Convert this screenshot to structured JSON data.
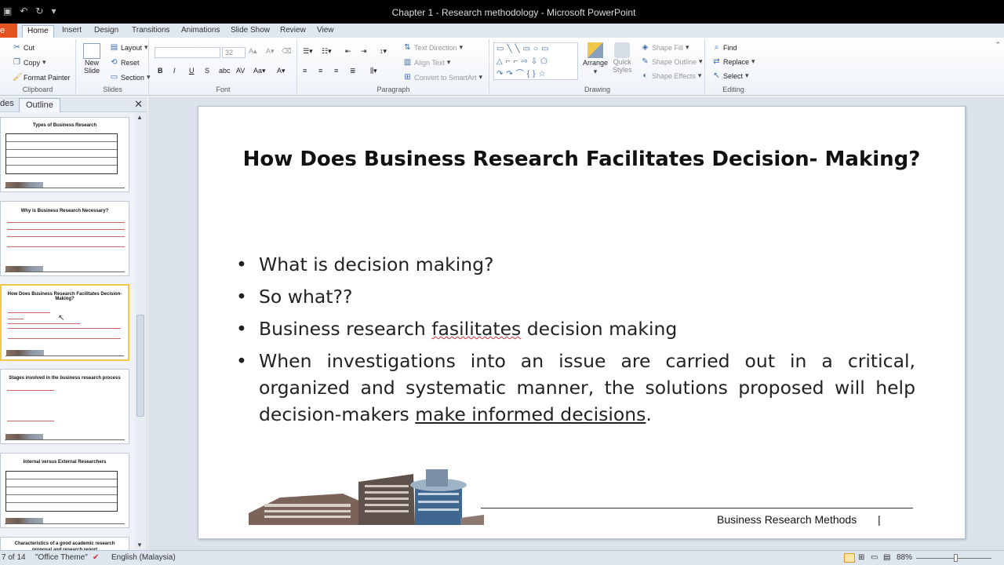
{
  "window": {
    "title": "Chapter 1 - Research methodology  -  Microsoft PowerPoint"
  },
  "tabs": {
    "file": "e",
    "items": [
      "Home",
      "Insert",
      "Design",
      "Transitions",
      "Animations",
      "Slide Show",
      "Review",
      "View"
    ],
    "active": "Home"
  },
  "ribbon": {
    "clipboard": {
      "cut": "Cut",
      "copy": "Copy",
      "format_painter": "Format Painter",
      "label": "Clipboard"
    },
    "slides": {
      "new_slide": "New",
      "new_slide2": "Slide",
      "layout": "Layout",
      "reset": "Reset",
      "section": "Section",
      "label": "Slides"
    },
    "font": {
      "size": "32",
      "label": "Font"
    },
    "paragraph": {
      "text_direction": "Text Direction",
      "align_text": "Align Text",
      "convert_smartart": "Convert to SmartArt",
      "label": "Paragraph"
    },
    "drawing": {
      "arrange": "Arrange",
      "quick_styles": "Quick",
      "quick_styles2": "Styles",
      "shape_fill": "Shape Fill",
      "shape_outline": "Shape Outline",
      "shape_effects": "Shape Effects",
      "label": "Drawing"
    },
    "editing": {
      "find": "Find",
      "replace": "Replace",
      "select": "Select",
      "label": "Editing"
    }
  },
  "pane": {
    "tab_slides": "des",
    "tab_outline": "Outline",
    "thumbs": [
      {
        "title": "Types of Business Research"
      },
      {
        "title": "Why is Business Research Necessary?"
      },
      {
        "title": "How Does Business Research Facilitates Decision- Making?"
      },
      {
        "title": "Stages involved in the business research process"
      },
      {
        "title": "Internal versus External Researchers"
      },
      {
        "title": "Characteristics of a good academic research proposal and research report"
      }
    ]
  },
  "slide": {
    "title": "How Does Business Research Facilitates Decision- Making?",
    "bullet1": "What is decision making?",
    "bullet2": "So what??",
    "bullet3_pre": "Business research ",
    "bullet3_mis": "fasilitates",
    "bullet3_post": " decision making",
    "bullet4_pre": "When investigations into an issue are carried out in a critical, organized and systematic manner, the solutions proposed will help decision-makers ",
    "bullet4_link": "make informed decisions",
    "bullet4_post": ".",
    "footer": "Business Research Methods",
    "footer_bar": "|"
  },
  "status": {
    "slide_count": "7 of 14",
    "theme": "\"Office Theme\"",
    "language": "English (Malaysia)",
    "zoom": "88%"
  }
}
